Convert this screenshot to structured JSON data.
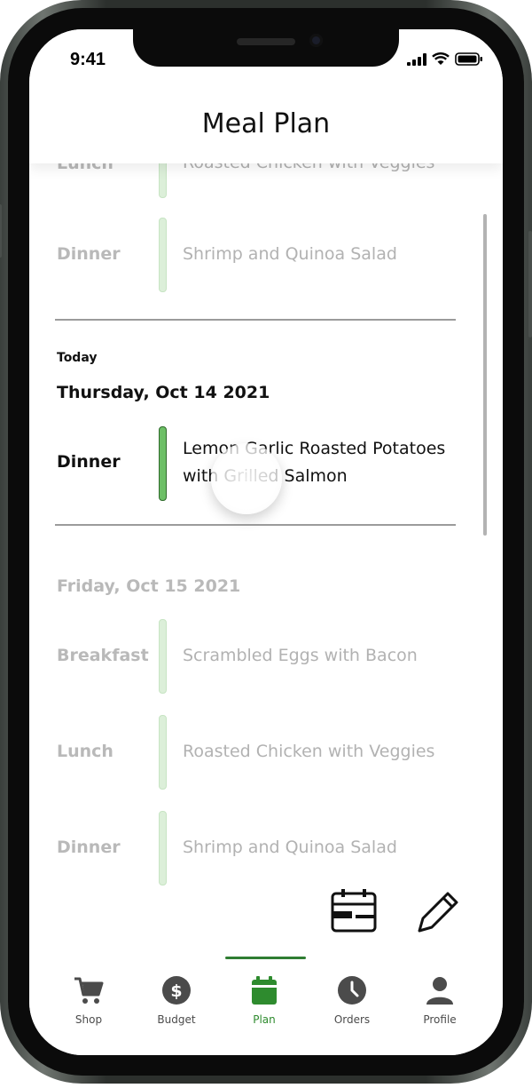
{
  "status_bar": {
    "time": "9:41"
  },
  "header": {
    "title": "Meal Plan"
  },
  "previous_day": {
    "meals": [
      {
        "label": "Lunch",
        "name": "Roasted Chicken with Veggies"
      },
      {
        "label": "Dinner",
        "name": "Shrimp and Quinoa Salad"
      }
    ]
  },
  "today": {
    "tag": "Today",
    "date": "Thursday, Oct 14 2021",
    "meals": [
      {
        "label": "Dinner",
        "name_line1": "Lemon Garlic Roasted Potatoes",
        "name_line2": "with Grilled Salmon"
      }
    ]
  },
  "next_day": {
    "date": "Friday, Oct 15 2021",
    "meals": [
      {
        "label": "Breakfast",
        "name": "Scrambled Eggs with Bacon"
      },
      {
        "label": "Lunch",
        "name": "Roasted Chicken with Veggies"
      },
      {
        "label": "Dinner",
        "name": "Shrimp and Quinoa Salad"
      }
    ]
  },
  "actions": {
    "calendar_icon": "calendar-icon",
    "edit_icon": "pencil-icon"
  },
  "tabs": [
    {
      "label": "Shop",
      "icon": "cart-icon",
      "active": false
    },
    {
      "label": "Budget",
      "icon": "dollar-icon",
      "active": false
    },
    {
      "label": "Plan",
      "icon": "calendar-icon",
      "active": true
    },
    {
      "label": "Orders",
      "icon": "clock-icon",
      "active": false
    },
    {
      "label": "Profile",
      "icon": "person-icon",
      "active": false
    }
  ],
  "colors": {
    "accent": "#2e8b2e",
    "bar_active": "#6dbf66",
    "bar_faded": "#dcefd9"
  }
}
